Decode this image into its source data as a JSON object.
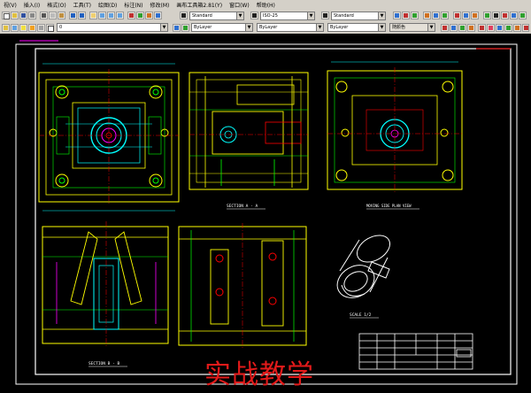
{
  "menu": {
    "items": [
      "视(V)",
      "插入(I)",
      "格式(O)",
      "工具(T)",
      "绘图(D)",
      "标注(N)",
      "修改(M)",
      "画布工具箱2.81(Y)",
      "窗口(W)",
      "帮助(H)"
    ]
  },
  "toolbar1": {
    "textstyle_value": "Standard",
    "dimstyle_value": "ISO-25",
    "tablestyle_value": "Standard"
  },
  "toolbar2": {
    "layer_value": "0",
    "color_value": "ByLayer",
    "linetype_value": "ByLayer",
    "lineweight_value": "ByLayer",
    "plotstyle_value": "随颜色"
  },
  "drawing": {
    "labels": {
      "section_a": "SECTION A - A",
      "moving_half": "MOVING SIDE PLAN VIEW",
      "section_b": "SECTION B - B",
      "scale": "SCALE 1/2"
    }
  },
  "watermark": "实战教学",
  "colors": {
    "background": "#000000",
    "yellow": "#ffff00",
    "cyan": "#00ffff",
    "green": "#00ff00",
    "white": "#ffffff",
    "red": "#ff0000",
    "magenta": "#ff00ff",
    "watermark": "#e21a1a"
  }
}
